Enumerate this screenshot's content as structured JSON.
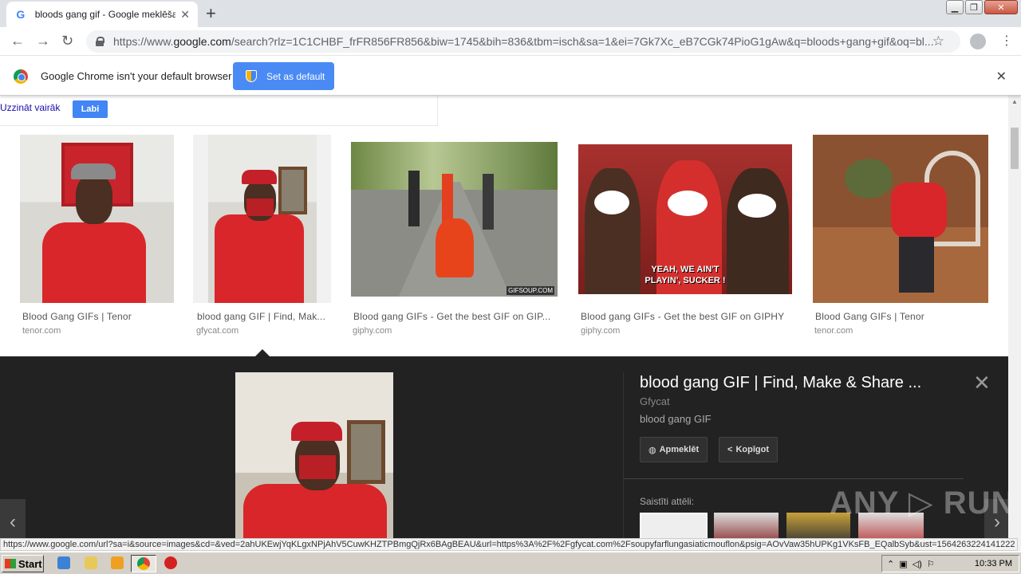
{
  "browser": {
    "tab_title": "bloods gang gif - Google meklēšana",
    "tab_favicon": "G",
    "tab_close": "✕",
    "new_tab": "+",
    "url_prefix": "https://www.",
    "url_host": "google.com",
    "url_path": "/search?rlz=1C1CHBF_frFR856FR856&biw=1745&bih=836&tbm=isch&sa=1&ei=7Gk7Xc_eB7CGk74PioG1gAw&q=bloods+gang+gif&oq=bl...",
    "back": "←",
    "forward": "→",
    "reload": "↻",
    "star": "☆",
    "menu": "⋮",
    "win_minimize": "▁",
    "win_restore": "❐",
    "win_close": "✕"
  },
  "infobar": {
    "message": "Google Chrome isn't your default browser",
    "button": "Set as default",
    "close": "✕"
  },
  "notice": {
    "learn_more": "Uzzināt vairāk",
    "ok": "Labi"
  },
  "results": [
    {
      "title": "Blood Gang GIFs | Tenor",
      "source": "tenor.com"
    },
    {
      "title": "blood gang GIF | Find, Mak...",
      "source": "gfycat.com"
    },
    {
      "title": "Blood gang GIFs - Get the best GIF on GIP...",
      "source": "giphy.com"
    },
    {
      "title": "Blood gang GIFs - Get the best GIF on GIPHY",
      "source": "giphy.com"
    },
    {
      "title": "Blood Gang GIFs | Tenor",
      "source": "tenor.com"
    }
  ],
  "image_captions": {
    "gifsoup": "GIFSOUP.COM",
    "southpark_line1": "YEAH, WE AIN'T",
    "southpark_line2": "PLAYIN', SUCKER !"
  },
  "preview": {
    "title": "blood gang GIF | Find, Make & Share ...",
    "source": "Gfycat",
    "description": "blood gang GIF",
    "visit_button": "Apmeklēt",
    "share_button": "Kopīgot",
    "close": "✕",
    "related_label": "Saistīti attēli:",
    "prev": "‹",
    "next": "›"
  },
  "status_url": "https://www.google.com/url?sa=i&source=images&cd=&ved=2ahUKEwjYqKLgxNPjAhV5CuwKHZTPBmgQjRx6BAgBEAU&url=https%3A%2F%2Fgfycat.com%2Fsoupyfarflungasiaticmouflon&psig=AOvVaw35hUPKg1VKsFB_EQalbSyb&ust=1564263224141222",
  "watermark": "ANY ▷ RUN",
  "taskbar": {
    "start": "Start",
    "clock": "10:33 PM"
  }
}
